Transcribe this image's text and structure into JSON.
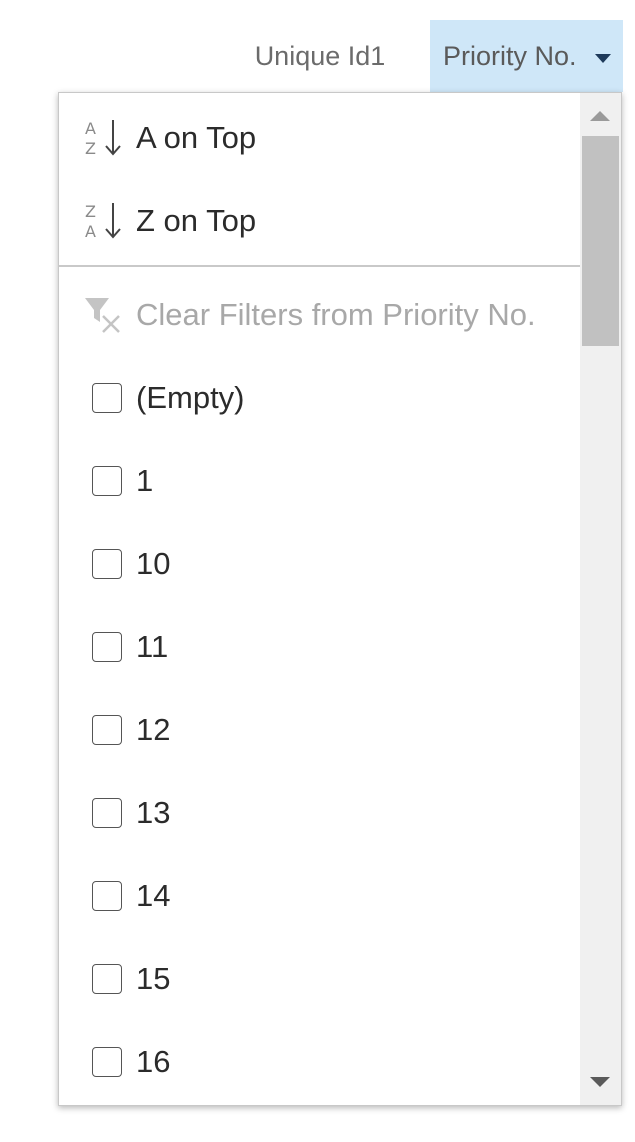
{
  "headers": {
    "unique_id": "Unique Id1",
    "priority": "Priority No."
  },
  "menu": {
    "sort_asc": "A on Top",
    "sort_desc": "Z on Top",
    "clear_filter": "Clear Filters from Priority No."
  },
  "values": [
    "(Empty)",
    "1",
    "10",
    "11",
    "12",
    "13",
    "14",
    "15",
    "16"
  ],
  "colors": {
    "header_active_bg": "#cfe7f8",
    "disabled_text": "#a8a8a8",
    "scroll_thumb": "#c1c1c1"
  }
}
